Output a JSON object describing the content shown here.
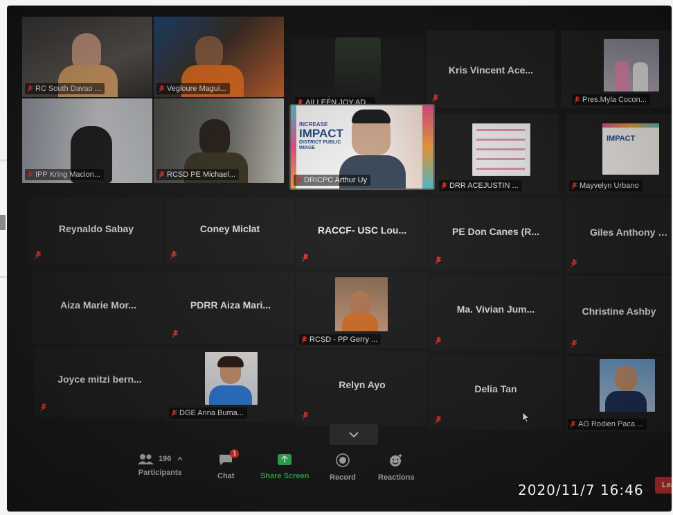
{
  "meeting": {
    "participants_count": "196",
    "toolbar": {
      "participants": "Participants",
      "chat": "Chat",
      "chat_badge": "1",
      "share_screen": "Share Screen",
      "record": "Record",
      "reactions": "Reactions",
      "leave": "Leav"
    }
  },
  "tiles": {
    "t1": "RC South Davao ...",
    "t2": "Vegloure Magui...",
    "t3": "AILLEEN JOY AD...",
    "t4": "Kris Vincent Ace...",
    "t5": "Pres.Myla Cocon...",
    "t6": "IPP Kring Macion...",
    "t7": "RCSD PE Michael...",
    "t8": "DRICPC Arthur Uy",
    "t9": "DRR ACEJUSTIN ...",
    "t10": "Mayvelyn Urbano",
    "t11": "Reynaldo Sabay",
    "t12": "Coney Miclat",
    "t13": "RACCF- USC Lou...",
    "t14": "PE Don Canes (R...",
    "t15": "Giles Anthony V...",
    "t16": "Aiza Marie Mor...",
    "t17": "PDRR Aiza Mari...",
    "t18": "RCSD - PP Gerry ...",
    "t19": "Ma. Vivian Jum...",
    "t20": "Christine Ashby",
    "t21": "Joyce mitzi bern...",
    "t22": "DGE Anna Buma...",
    "t23": "Relyn Ayo",
    "t24": "Delia Tan",
    "t25": "AG Rodien Paca ..."
  },
  "slide": {
    "line1": "INCREASE",
    "line2": "IMPACT",
    "line3": "DISTRICT PUBLIC",
    "line4": "IMAGE"
  },
  "timestamp": "2020/11/7  16:46",
  "colors": {
    "muted_mic": "#e0312b",
    "share_green": "#2ec25a",
    "leave_red": "#c8322f"
  }
}
